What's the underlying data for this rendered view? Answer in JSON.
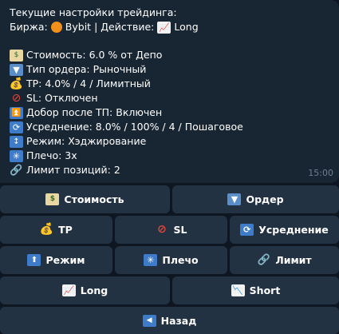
{
  "message": {
    "header": "Текущие настройки трейдинга:",
    "exchange_prefix": "Биржа:",
    "exchange_name": "Bybit",
    "action_prefix": "| Действие:",
    "action_value": "Long",
    "lines": [
      {
        "icon": "money-icon",
        "text": "Стоимость: 6.0 % от Депо"
      },
      {
        "icon": "inbox-tray-icon",
        "text": "Тип ордера: Рыночный"
      },
      {
        "icon": "money-bag-icon",
        "text": "TP: 4.0% / 4 / Лимитный"
      },
      {
        "icon": "prohibited-icon",
        "text": "SL: Отключен"
      },
      {
        "icon": "up-arrow-icon",
        "text": "Добор после ТП: Включен"
      },
      {
        "icon": "repeat-icon",
        "text": "Усреднение: 8.0% / 100% / 4 / Пошаговое"
      },
      {
        "icon": "up-down-arrow-icon",
        "text": "Режим: Хэджирование"
      },
      {
        "icon": "asterisk-icon",
        "text": "Плечо: 3x"
      },
      {
        "icon": "link-icon",
        "text": "Лимит позиций: 2"
      }
    ],
    "time": "15:00"
  },
  "keyboard": {
    "cost": "Стоимость",
    "order": "Ордер",
    "tp": "TP",
    "sl": "SL",
    "averaging": "Усреднение",
    "mode": "Режим",
    "leverage": "Плечо",
    "limit": "Лимит",
    "long": "Long",
    "short": "Short",
    "back": "Назад"
  }
}
